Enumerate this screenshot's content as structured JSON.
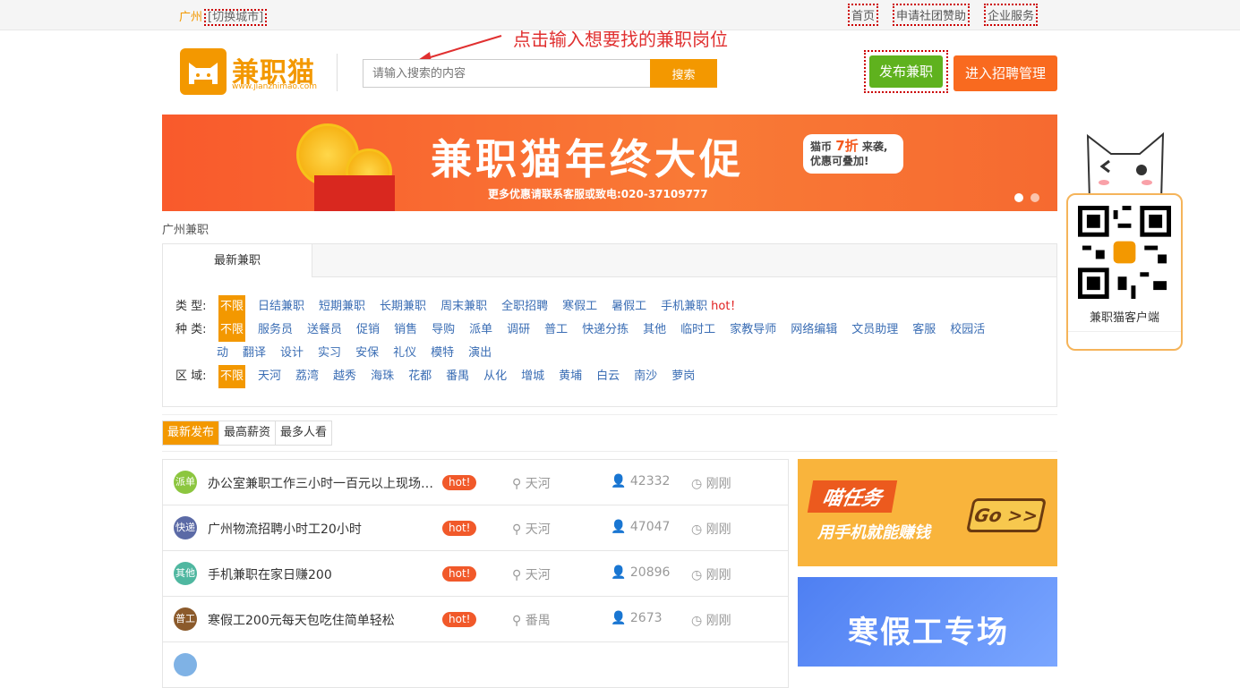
{
  "topbar": {
    "city": "广州",
    "switch_city": "[切换城市]",
    "links": [
      "首页",
      "申请社团赞助",
      "企业服务"
    ]
  },
  "header": {
    "logo_text": "兼职猫",
    "logo_url_text": "www.jianzhimao.com",
    "search_placeholder": "请输入搜索的内容",
    "search_button": "搜索",
    "annotation": "点击输入想要找的兼职岗位",
    "publish_button": "发布兼职",
    "manage_button": "进入招聘管理"
  },
  "banner": {
    "title": "兼职猫年终大促",
    "badge_prefix": "猫币",
    "badge_highlight": "7折",
    "badge_suffix": "来袭,",
    "badge_line2": "优惠可叠加!",
    "subtitle": "更多优惠请联系客服或致电:020-37109777"
  },
  "breadcrumb": "广州兼职",
  "filter": {
    "tab": "最新兼职",
    "type": {
      "label": "类  型:",
      "options": [
        "不限",
        "日结兼职",
        "短期兼职",
        "长期兼职",
        "周末兼职",
        "全职招聘",
        "寒假工",
        "暑假工",
        "手机兼职"
      ],
      "hot": "hot！"
    },
    "kind": {
      "label": "种  类:",
      "options_line1": [
        "不限",
        "服务员",
        "送餐员",
        "促销",
        "销售",
        "导购",
        "派单",
        "调研",
        "普工",
        "快递分拣",
        "其他",
        "临时工",
        "家教导师",
        "网络编辑",
        "文员助理",
        "客服",
        "校园活"
      ],
      "options_line2": [
        "动",
        "翻译",
        "设计",
        "实习",
        "安保",
        "礼仪",
        "模特",
        "演出"
      ]
    },
    "area": {
      "label": "区  域:",
      "options": [
        "不限",
        "天河",
        "荔湾",
        "越秀",
        "海珠",
        "花都",
        "番禺",
        "从化",
        "增城",
        "黄埔",
        "白云",
        "南沙",
        "萝岗"
      ]
    }
  },
  "sort_tabs": [
    "最新发布",
    "最高薪资",
    "最多人看"
  ],
  "jobs": [
    {
      "avatar": "派单",
      "color": "#8cc63f",
      "title": "办公室兼职工作三小时一百元以上现场结算",
      "hot": "hot!",
      "location": "天河",
      "views": "42332",
      "time": "刚刚"
    },
    {
      "avatar": "快递",
      "color": "#5b6aa6",
      "title": "广州物流招聘小时工20小时",
      "hot": "hot!",
      "location": "天河",
      "views": "47047",
      "time": "刚刚"
    },
    {
      "avatar": "其他",
      "color": "#4fb7a0",
      "title": "手机兼职在家日赚200",
      "hot": "hot!",
      "location": "天河",
      "views": "20896",
      "time": "刚刚"
    },
    {
      "avatar": "普工",
      "color": "#8b5a2b",
      "title": "寒假工200元每天包吃住简单轻松",
      "hot": "hot!",
      "location": "番禺",
      "views": "2673",
      "time": "刚刚"
    }
  ],
  "ads": {
    "ad1_title": "喵任务",
    "ad1_sub": "用手机就能赚钱",
    "ad1_go": "Go >>",
    "ad2_title": "寒假工专场"
  },
  "qr": {
    "label": "兼职猫客户端"
  },
  "colors": {
    "brand_orange": "#f39800",
    "publish_green": "#5fb21e",
    "manage_orange": "#f96a1f",
    "link_blue": "#3a6db4"
  }
}
